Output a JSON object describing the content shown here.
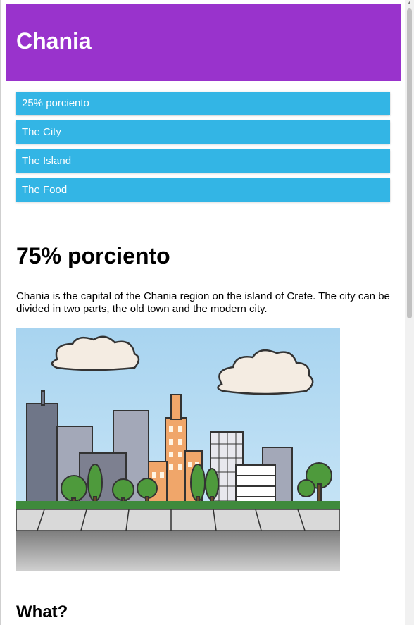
{
  "header": {
    "title": "Chania"
  },
  "menu": {
    "items": [
      {
        "label": "25% porciento"
      },
      {
        "label": "The City"
      },
      {
        "label": "The Island"
      },
      {
        "label": "The Food"
      }
    ]
  },
  "main": {
    "heading": "75% porciento",
    "paragraph": "Chania is the capital of the Chania region on the island of Crete. The city can be divided in two parts, the old town and the modern city.",
    "image_icon": "city-skyline-illustration",
    "subheading": "What?"
  },
  "colors": {
    "header_bg": "#9933cc",
    "menu_bg": "#33b5e5",
    "header_text": "#ffffff"
  }
}
